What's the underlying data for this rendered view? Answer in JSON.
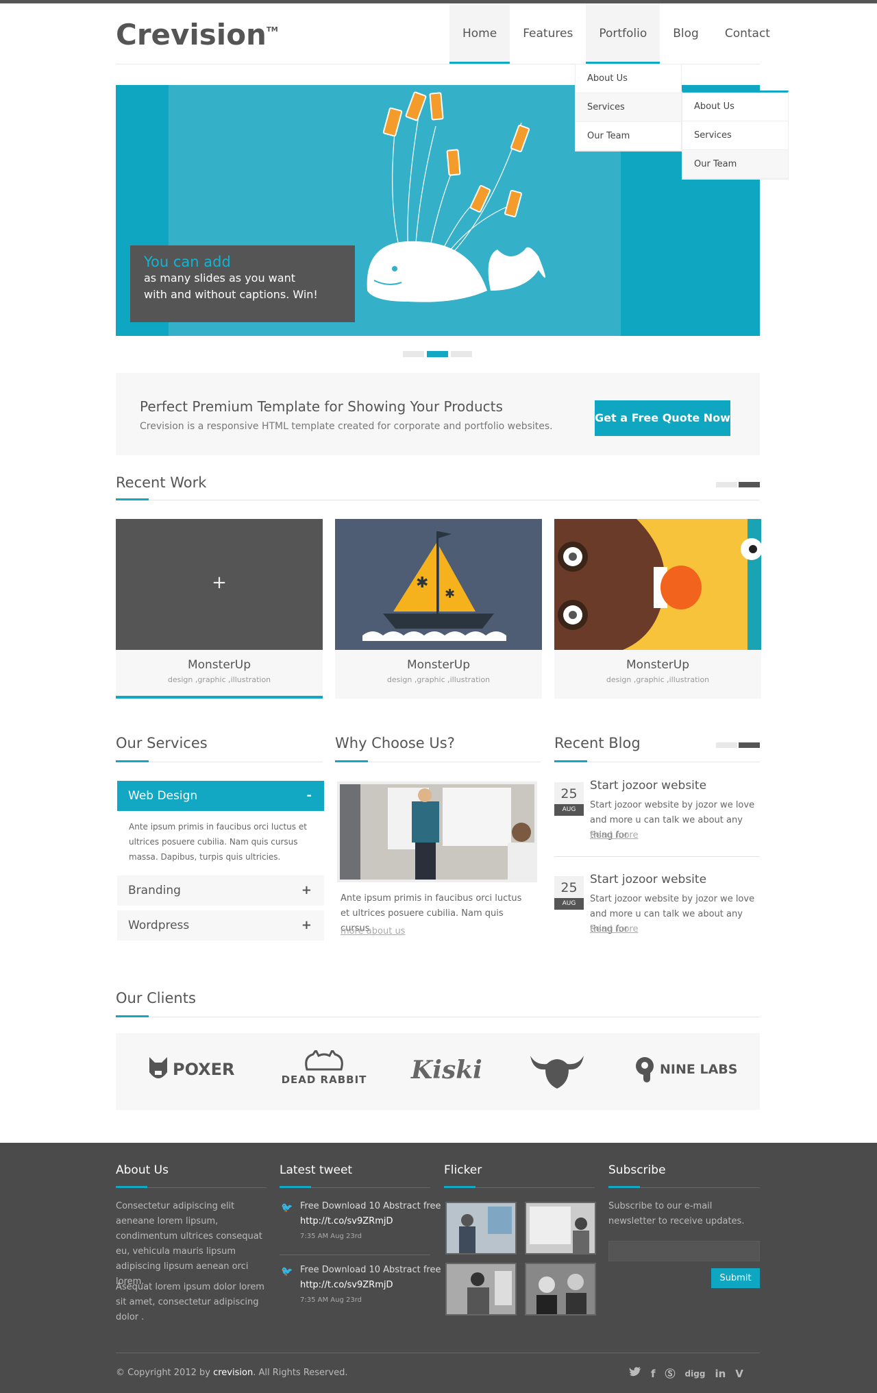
{
  "header": {
    "logo": "Crevision",
    "logo_tm": "TM",
    "nav": [
      "Home",
      "Features",
      "Portfolio",
      "Blog",
      "Contact"
    ]
  },
  "dropdown": {
    "level1": [
      "About Us",
      "Services",
      "Our Team"
    ],
    "level2": [
      "About Us",
      "Services",
      "Our Team"
    ]
  },
  "slider": {
    "caption_title": "You can add",
    "caption_line1": "as many slides as you want",
    "caption_line2": "with and without captions. Win!",
    "active_dot": 2,
    "dot_count": 3
  },
  "promo": {
    "title": "Perfect Premium Template for Showing Your Products",
    "text": "Crevision is a responsive HTML template created for corporate and portfolio websites.",
    "button": "Get a Free Quote Now"
  },
  "recent_work": {
    "title": "Recent Work",
    "items": [
      {
        "title": "MonsterUp",
        "tags": "design ,graphic ,illustration",
        "overlay_icon": "+"
      },
      {
        "title": "MonsterUp",
        "tags": "design ,graphic ,illustration"
      },
      {
        "title": "MonsterUp",
        "tags": "design ,graphic ,illustration"
      }
    ]
  },
  "services": {
    "title": "Our Services",
    "items": [
      {
        "label": "Web Design",
        "sign": "-",
        "body": "Ante ipsum primis in faucibus orci luctus et ultrices posuere cubilia. Nam quis cursus massa. Dapibus, turpis quis ultricies."
      },
      {
        "label": "Branding",
        "sign": "+"
      },
      {
        "label": "Wordpress",
        "sign": "+"
      }
    ]
  },
  "why": {
    "title": "Why Choose Us?",
    "text": "Ante ipsum primis in faucibus orci luctus et ultrices posuere cubilia. Nam quis cursus",
    "link": "more about us"
  },
  "blog": {
    "title": "Recent Blog",
    "posts": [
      {
        "day": "25",
        "month": "AUG",
        "title": "Start jozoor website",
        "text": "Start jozoor website by jozor we love and more u can talk we about any thing for",
        "link": "Read more"
      },
      {
        "day": "25",
        "month": "AUG",
        "title": "Start jozoor website",
        "text": "Start jozoor website by jozor we love and more u can talk we about any thing for",
        "link": "Read more"
      }
    ]
  },
  "clients": {
    "title": "Our Clients",
    "logos": [
      "POXER",
      "DEAD RABBIT",
      "Kiski",
      "",
      "NINE LABS"
    ]
  },
  "footer": {
    "about_title": "About Us",
    "about_p1": "Consectetur adipiscing elit aeneane lorem lipsum, condimentum ultrices consequat eu, vehicula mauris lipsum adipiscing lipsum aenean orci lorem.",
    "about_p2": "Asequat lorem ipsum dolor lorem sit amet, consectetur adipiscing dolor .",
    "tweet_title": "Latest tweet",
    "tweets": [
      {
        "text": "Free Download 10 Abstract free",
        "link": "http://t.co/sv9ZRmjD",
        "time": "7:35 AM Aug 23rd"
      },
      {
        "text": "Free Download 10 Abstract free",
        "link": "http://t.co/sv9ZRmjD",
        "time": "7:35 AM Aug 23rd"
      }
    ],
    "flickr_title": "Flicker",
    "subscribe_title": "Subscribe",
    "subscribe_text": "Subscribe to our e-mail newsletter to receive updates.",
    "subscribe_button": "Submit",
    "copyright_pre": "© Copyright 2012 by ",
    "copyright_brand": "crevision",
    "copyright_post": ". All Rights Reserved.",
    "social": [
      "twitter-icon",
      "facebook-icon",
      "skype-icon",
      "digg-icon",
      "linkedin-icon",
      "vimeo-icon"
    ],
    "social_text": {
      "digg": "digg",
      "linkedin": "in"
    }
  },
  "colors": {
    "accent": "#12a8c4",
    "dark": "#555555",
    "footer": "#4b4b4b"
  }
}
